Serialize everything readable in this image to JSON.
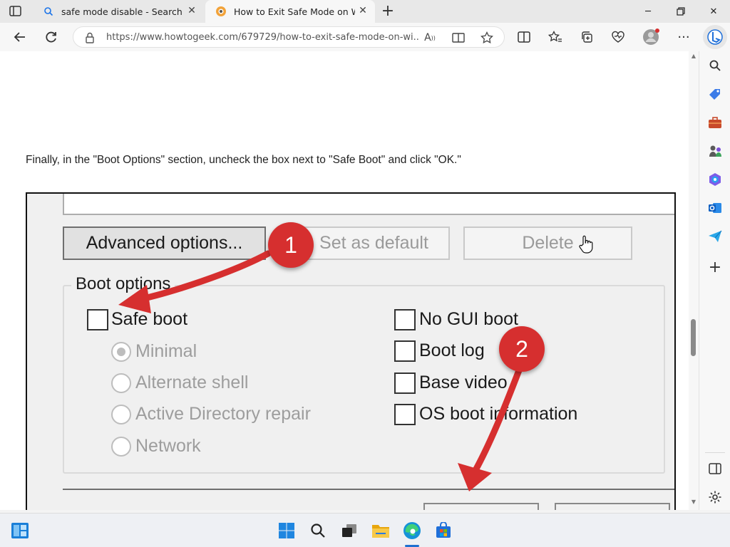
{
  "browser": {
    "tabs": [
      {
        "title": "safe mode disable - Search",
        "active": false
      },
      {
        "title": "How to Exit Safe Mode on Windo",
        "active": true
      }
    ],
    "address": {
      "url": "https://www.howtogeek.com/679729/how-to-exit-safe-mode-on-wi..."
    }
  },
  "article": {
    "paragraph": "Finally, in the \"Boot Options\" section, uncheck the box next to \"Safe Boot\" and click \"OK.\""
  },
  "dialog": {
    "buttons": {
      "advanced": "Advanced options...",
      "set_default": "Set as default",
      "delete": "Delete"
    },
    "boot_options_label": "Boot options",
    "safe_boot": "Safe boot",
    "radios": [
      {
        "label": "Minimal",
        "selected": true
      },
      {
        "label": "Alternate shell",
        "selected": false
      },
      {
        "label": "Active Directory repair",
        "selected": false
      },
      {
        "label": "Network",
        "selected": false
      }
    ],
    "right_checks": [
      "No GUI boot",
      "Boot log",
      "Base video",
      "OS boot information"
    ]
  },
  "annotations": {
    "badge1": "1",
    "badge2": "2",
    "color": "#d62f2f"
  },
  "colors": {
    "accent": "#0a63c9",
    "annotation_red": "#d62f2f"
  }
}
